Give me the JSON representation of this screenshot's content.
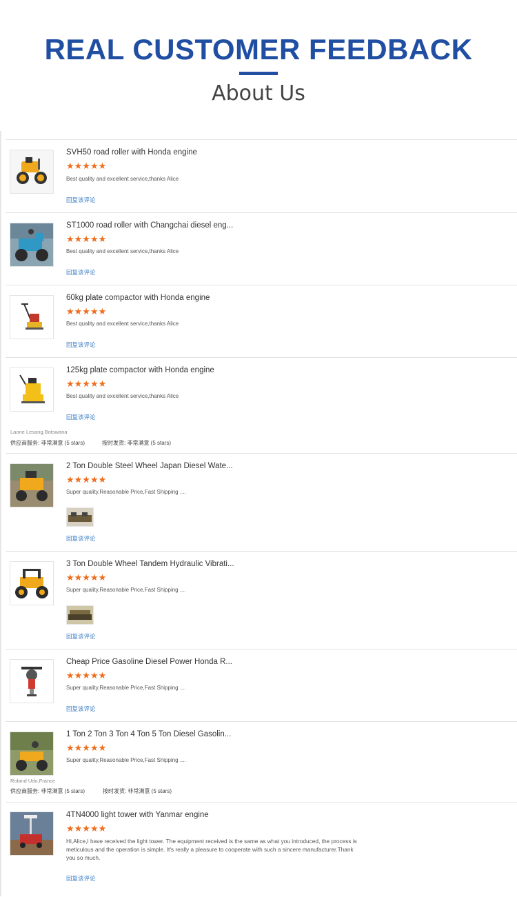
{
  "header": {
    "title": "REAL CUSTOMER FEEDBACK",
    "subtitle": "About Us"
  },
  "colors": {
    "brand_blue": "#1f4ea3",
    "star_orange": "#ee6c1b",
    "link_blue": "#3b7dc4"
  },
  "reply_label": "回复该评论",
  "stars_text": "★★★★★",
  "reviews": [
    {
      "title": "SVH50 road roller with Honda engine",
      "stars": 5,
      "comment": "Best quality and excellent service,thanks Alice",
      "icon": "road-roller-icon"
    },
    {
      "title": "ST1000 road roller with Changchai diesel eng...",
      "stars": 5,
      "comment": "Best quality and excellent service,thanks Alice",
      "icon": "road-roller-icon"
    },
    {
      "title": "60kg plate compactor with Honda engine",
      "stars": 5,
      "comment": "Best quality and excellent service,thanks Alice",
      "icon": "plate-compactor-icon"
    },
    {
      "title": "125kg plate compactor with Honda engine",
      "stars": 5,
      "comment": "Best quality and excellent service,thanks Alice",
      "icon": "plate-compactor-icon"
    },
    {
      "title": "2 Ton Double Steel Wheel Japan Diesel Wate...",
      "stars": 5,
      "comment": "Super quality,Reasonable Price,Fast Shipping ....",
      "icon": "road-roller-icon"
    },
    {
      "title": "3 Ton Double Wheel Tandem Hydraulic Vibrati...",
      "stars": 5,
      "comment": "Super quality,Reasonable Price,Fast Shipping ....",
      "icon": "road-roller-icon"
    },
    {
      "title": "Cheap Price Gasoline Diesel Power Honda R...",
      "stars": 5,
      "comment": "Super quality,Reasonable Price,Fast Shipping ....",
      "icon": "tamping-rammer-icon"
    },
    {
      "title": "1 Ton 2 Ton 3 Ton 4 Ton 5 Ton Diesel Gasolin...",
      "stars": 5,
      "comment": "Super quality,Reasonable Price,Fast Shipping ....",
      "icon": "road-roller-icon"
    },
    {
      "title": "4TN4000 light tower with Yanmar engine",
      "stars": 5,
      "comment": "Hi,Alice,I have received the light tower.  The equipment received is the same as what you introduced, the process is meticulous and the operation is simple. It's really a pleasure to cooperate with such a sincere manufacturer.Thank you so much.",
      "icon": "light-tower-icon"
    }
  ],
  "reviewer_1": {
    "name": "Laone Lesang,Botswana",
    "supplier_service": "供应商服务:  非常满意  (5 stars)",
    "on_time_delivery": "按时发货:  非常满意  (5 stars)"
  },
  "reviewer_2": {
    "name": "Roland Udo,France",
    "supplier_service": "供应商服务:  非常满意  (5 stars)",
    "on_time_delivery": "按时发货:  非常满意  (5 stars)"
  }
}
